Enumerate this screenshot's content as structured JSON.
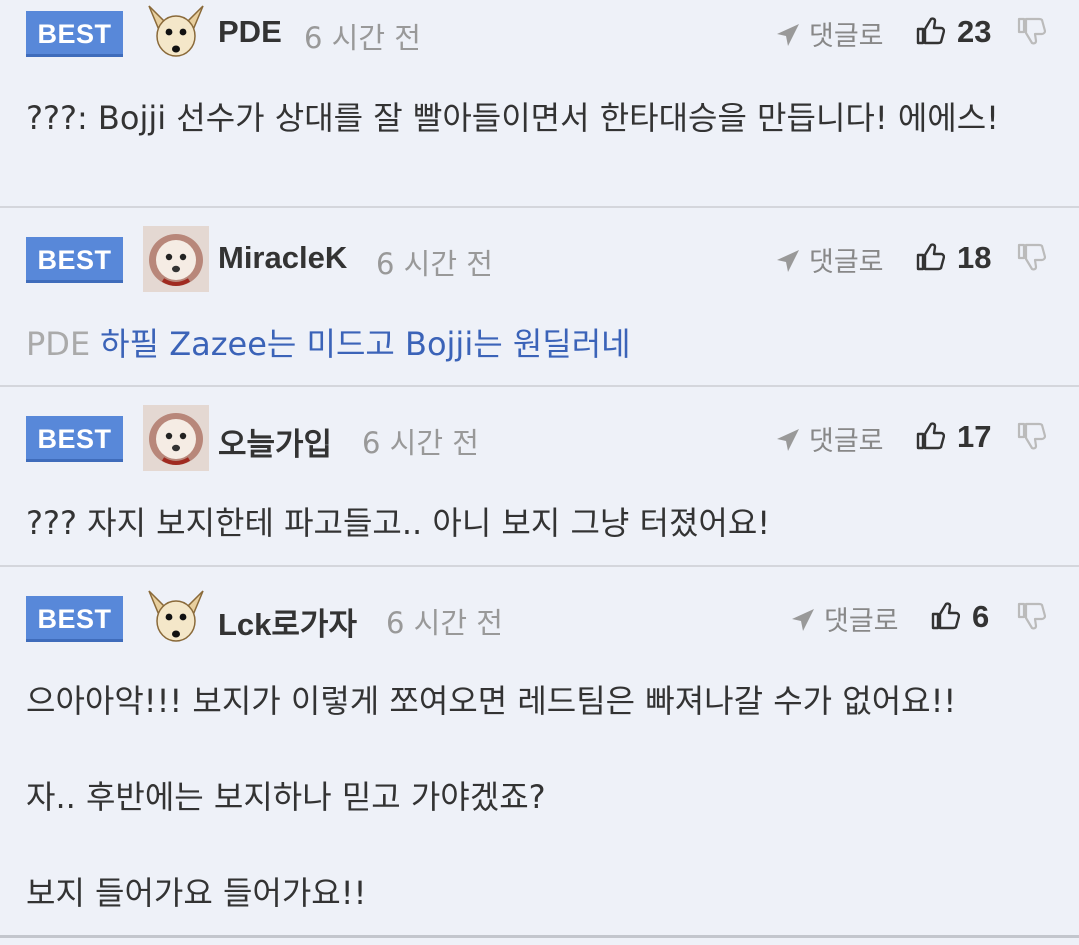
{
  "comments": [
    {
      "badge": "BEST",
      "author": "PDE",
      "time": "6 시간 전",
      "reply": "댓글로",
      "likes": "23",
      "body": "???: Bojji 선수가 상대를 잘 빨아들이면서 한타대승을 만듭니다! 에에스!"
    },
    {
      "badge": "BEST",
      "author": "MiracleK",
      "time": "6 시간 전",
      "reply": "댓글로",
      "likes": "18",
      "mention": "PDE",
      "body": "하필 Zazee는 미드고 Bojji는 원딜러네"
    },
    {
      "badge": "BEST",
      "author": "오늘가입",
      "time": "6 시간 전",
      "reply": "댓글로",
      "likes": "17",
      "body": "??? 자지 보지한테 파고들고.. 아니 보지 그냥 터졌어요!"
    },
    {
      "badge": "BEST",
      "author": "Lck로가자",
      "time": "6 시간 전",
      "reply": "댓글로",
      "likes": "6",
      "body_lines": [
        "으아아악!!! 보지가 이렇게 쪼여오면 레드팀은 빠져나갈 수가 없어요!!",
        "자.. 후반에는 보지하나 믿고 가야겠죠?",
        "보지 들어가요 들어가요!!"
      ]
    }
  ],
  "icons": {
    "reply": "send-arrow-icon",
    "like": "thumbs-up-icon",
    "dislike": "thumbs-down-icon",
    "avatar_dog": "chihuahua-avatar",
    "avatar_pup": "puppy-avatar"
  },
  "colors": {
    "background": "#eef1f8",
    "badge": "#5888d9",
    "link": "#3b63b8",
    "muted": "#999999"
  }
}
